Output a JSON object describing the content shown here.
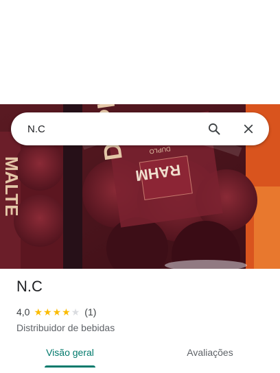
{
  "search": {
    "query": "N.C"
  },
  "icons": {
    "search": "search-icon",
    "close": "close-icon"
  },
  "place": {
    "name": "N.C",
    "rating": "4,0",
    "rating_value": 4.0,
    "stars_max": 5,
    "review_count": "(1)",
    "category": "Distribuidor de bebidas"
  },
  "photo_text": {
    "brand": "MALTE",
    "big": "DUPLO",
    "small": "DUPLO",
    "rahm": "RAHM"
  },
  "tabs": [
    {
      "label": "Visão geral",
      "active": true
    },
    {
      "label": "Avaliações",
      "active": false
    }
  ],
  "colors": {
    "accent": "#00796b",
    "star": "#fbbc04",
    "star_empty": "#dadce0"
  }
}
